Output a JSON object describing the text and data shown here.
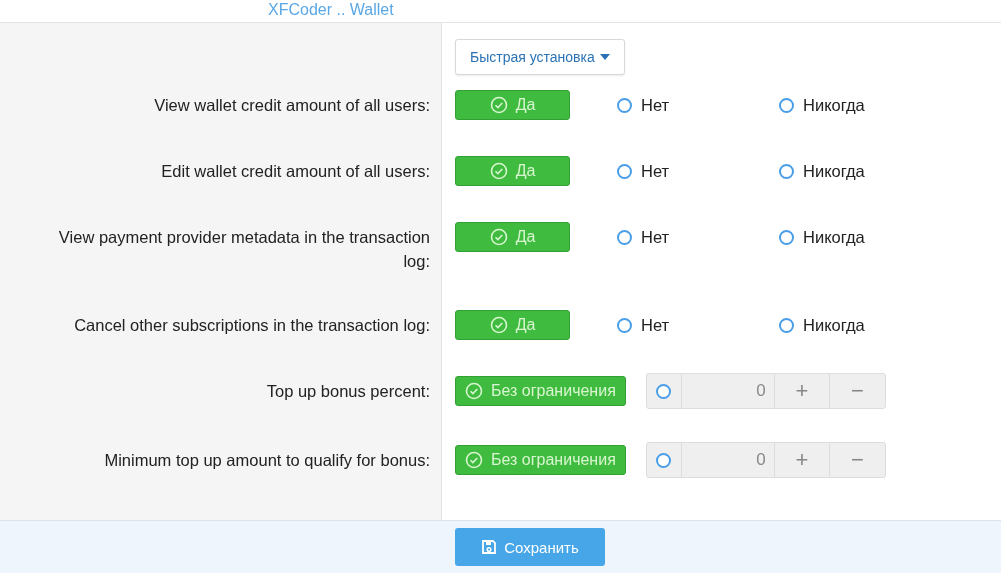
{
  "header": {
    "title": "XFCoder .. Wallet"
  },
  "quick_setup": {
    "label": "Быстрая установка"
  },
  "rows": [
    {
      "kind": "choice",
      "label": "View wallet credit amount of all users:",
      "options": [
        {
          "label": "Да",
          "selected": true
        },
        {
          "label": "Нет",
          "selected": false
        },
        {
          "label": "Никогда",
          "selected": false
        }
      ]
    },
    {
      "kind": "choice",
      "label": "Edit wallet credit amount of all users:",
      "options": [
        {
          "label": "Да",
          "selected": true
        },
        {
          "label": "Нет",
          "selected": false
        },
        {
          "label": "Никогда",
          "selected": false
        }
      ]
    },
    {
      "kind": "choice",
      "label": "View payment provider metadata in the transaction log:",
      "options": [
        {
          "label": "Да",
          "selected": true
        },
        {
          "label": "Нет",
          "selected": false
        },
        {
          "label": "Никогда",
          "selected": false
        }
      ]
    },
    {
      "kind": "choice",
      "label": "Cancel other subscriptions in the transaction log:",
      "options": [
        {
          "label": "Да",
          "selected": true
        },
        {
          "label": "Нет",
          "selected": false
        },
        {
          "label": "Никогда",
          "selected": false
        }
      ]
    },
    {
      "kind": "limit",
      "label": "Top up bonus percent:",
      "unlimited": {
        "label": "Без ограничения",
        "selected": true
      },
      "value": {
        "selected": false,
        "text": "0"
      },
      "plus": "+",
      "minus": "−"
    },
    {
      "kind": "limit",
      "label": "Minimum top up amount to qualify for bonus:",
      "unlimited": {
        "label": "Без ограничения",
        "selected": true
      },
      "value": {
        "selected": false,
        "text": "0"
      },
      "plus": "+",
      "minus": "−"
    }
  ],
  "footer": {
    "save_label": "Сохранить"
  }
}
